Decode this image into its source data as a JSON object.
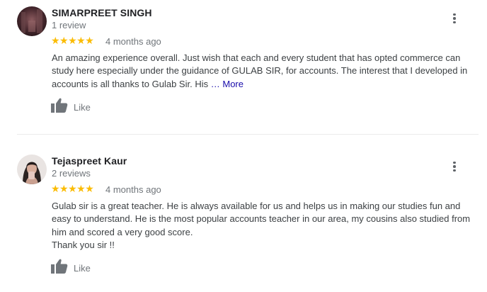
{
  "reviews": [
    {
      "name": "SIMARPREET SINGH",
      "review_count": "1 review",
      "stars": "★★★★★",
      "rating": 5,
      "date": "4 months ago",
      "text": "An amazing experience overall. Just wish that each and every student that has opted commerce can study here especially under the guidance of GULAB SIR, for accounts. The interest that I developed in accounts is all thanks to Gulab Sir. His",
      "ellipsis": "…",
      "more_label": "More",
      "like_label": "Like"
    },
    {
      "name": "Tejaspreet Kaur",
      "review_count": "2 reviews",
      "stars": "★★★★★",
      "rating": 5,
      "date": "4 months ago",
      "text_lines": [
        "Gulab sir is a great teacher.  He is always available for us and helps us in making our studies fun and easy to understand.  He is the most popular accounts teacher in our area, my cousins also studied from him and scored a very good score.",
        "Thank you sir !!"
      ],
      "like_label": "Like"
    }
  ],
  "icons": {
    "menu": "more-vert-icon",
    "like": "thumbs-up-icon"
  },
  "colors": {
    "star": "#fbbc04",
    "link": "#1a0dab",
    "muted": "#70757a"
  }
}
